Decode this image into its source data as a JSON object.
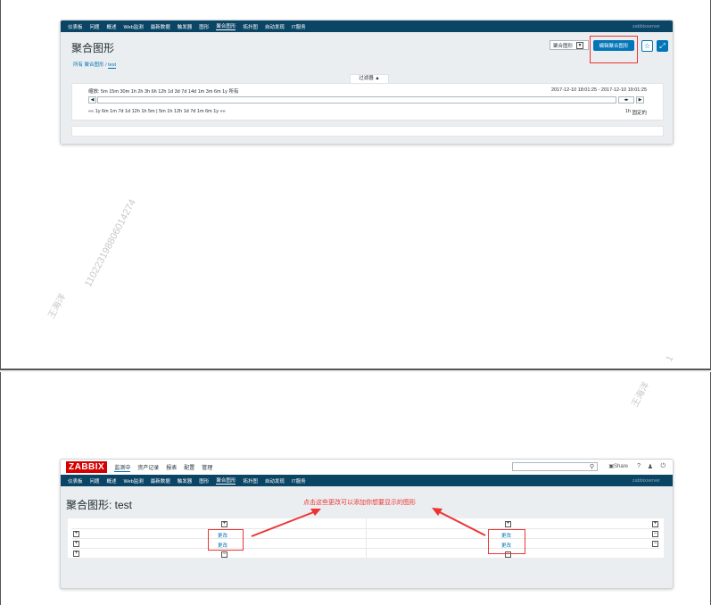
{
  "shot1": {
    "subnav": [
      "仪表板",
      "问题",
      "概述",
      "Web监测",
      "最新数据",
      "触发器",
      "图形",
      "聚合图形",
      "拓扑图",
      "自动发现",
      "IT服务"
    ],
    "server": "zabbixserver",
    "title": "聚合图形",
    "select_value": "聚合图形",
    "edit_button": "编辑聚合图形",
    "breadcrumb": {
      "all": "所有 聚合图形",
      "sep": "/",
      "current": "test"
    },
    "filter_tab": "过滤器 ▲",
    "zoom_row": "缩放: 5m  15m  30m  1h  2h  3h  6h  12h  1d  3d  7d  14d  1m  3m  6m  1y  所有",
    "time_range": "2017-12-10 18:01:25 - 2017-12-10 19:01:25",
    "shift_row": "««  1y  6m  1m  7d  1d  12h  1h  5m  |  5m  1h  12h  1d  7d  1m  6m  1y  »»",
    "period": "1h",
    "fixed": "固定的"
  },
  "shot2": {
    "logo": "ZABBIX",
    "menu": [
      "监测中",
      "资产记录",
      "报表",
      "配置",
      "管理"
    ],
    "share": "Share",
    "help": "?",
    "subnav": [
      "仪表板",
      "问题",
      "概述",
      "Web监测",
      "最新数据",
      "触发器",
      "图形",
      "聚合图形",
      "拓扑图",
      "自动发现",
      "IT服务"
    ],
    "server": "zabbixserver",
    "title": "聚合图形: test",
    "change_left": [
      "更改",
      "更改"
    ],
    "change_right": [
      "更改",
      "更改"
    ],
    "annotation": "点击这些更改可以添加你想要显示的图形"
  },
  "watermark": {
    "name": "王海洋",
    "number": "110223198806014274",
    "edge": "1"
  },
  "colors": {
    "accent": "#0275b8",
    "nav": "#0b4565",
    "highlight": "#ee3333",
    "logo": "#d40000"
  }
}
